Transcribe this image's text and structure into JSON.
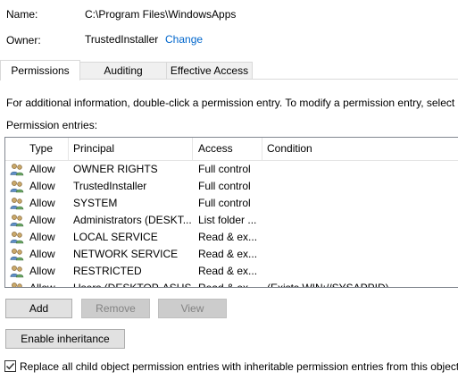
{
  "info": {
    "name_label": "Name:",
    "name_value": "C:\\Program Files\\WindowsApps",
    "owner_label": "Owner:",
    "owner_value": "TrustedInstaller",
    "change_link": "Change"
  },
  "tabs": [
    {
      "label": "Permissions",
      "active": true
    },
    {
      "label": "Auditing",
      "active": false
    },
    {
      "label": "Effective Access",
      "active": false
    }
  ],
  "instructions": "For additional information, double-click a permission entry. To modify a permission entry, select",
  "entries_label": "Permission entries:",
  "table": {
    "headers": [
      "Type",
      "Principal",
      "Access",
      "Condition"
    ],
    "rows": [
      {
        "type": "Allow",
        "principal": "OWNER RIGHTS",
        "access": "Full control",
        "condition": ""
      },
      {
        "type": "Allow",
        "principal": "TrustedInstaller",
        "access": "Full control",
        "condition": ""
      },
      {
        "type": "Allow",
        "principal": "SYSTEM",
        "access": "Full control",
        "condition": ""
      },
      {
        "type": "Allow",
        "principal": "Administrators (DESKT...",
        "access": "List folder ...",
        "condition": ""
      },
      {
        "type": "Allow",
        "principal": "LOCAL SERVICE",
        "access": "Read & ex...",
        "condition": ""
      },
      {
        "type": "Allow",
        "principal": "NETWORK SERVICE",
        "access": "Read & ex...",
        "condition": ""
      },
      {
        "type": "Allow",
        "principal": "RESTRICTED",
        "access": "Read & ex...",
        "condition": ""
      },
      {
        "type": "Allow",
        "principal": "Users (DESKTOP-ASUS...",
        "access": "Read & ex...",
        "condition": "(Exists WIN://SYSAPPID)"
      }
    ]
  },
  "buttons": {
    "add": "Add",
    "remove": "Remove",
    "view": "View",
    "enable_inheritance": "Enable inheritance"
  },
  "replace_checkbox": {
    "label": "Replace all child object permission entries with inheritable permission entries from this object",
    "checked": true
  },
  "colors": {
    "link": "#0066cc",
    "checkbox_check": "#333333"
  },
  "icons": {
    "principal_icon": "users-icon"
  }
}
